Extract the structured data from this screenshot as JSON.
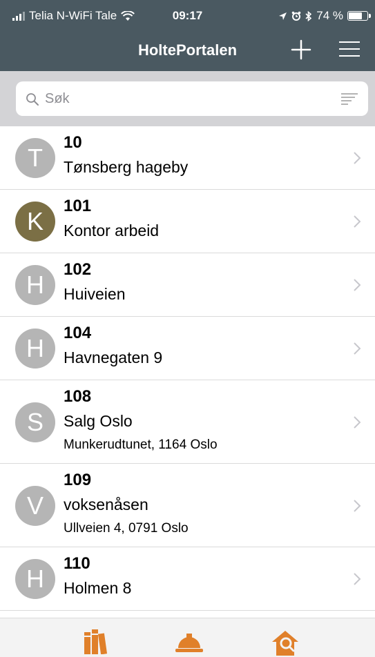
{
  "status_bar": {
    "carrier": "Telia N-WiFi Tale",
    "time": "09:17",
    "battery": "74 %",
    "battery_level": 0.74
  },
  "nav": {
    "title": "HoltePortalen"
  },
  "search": {
    "placeholder": "Søk",
    "value": ""
  },
  "colors": {
    "header": "#4a5961",
    "avatar_default": "#b5b5b5",
    "avatar_k": "#7b6f45",
    "tab_icon": "#e0802a"
  },
  "projects": [
    {
      "number": "10",
      "name": "Tønsberg hageby",
      "address": "",
      "initial": "T"
    },
    {
      "number": "101",
      "name": "Kontor arbeid",
      "address": "",
      "initial": "K"
    },
    {
      "number": "102",
      "name": "Huiveien",
      "address": "",
      "initial": "H"
    },
    {
      "number": "104",
      "name": "Havnegaten 9",
      "address": "",
      "initial": "H"
    },
    {
      "number": "108",
      "name": "Salg Oslo",
      "address": "Munkerudtunet, 1164 Oslo",
      "initial": "S"
    },
    {
      "number": "109",
      "name": "voksenåsen",
      "address": "Ullveien 4, 0791 Oslo",
      "initial": "V"
    },
    {
      "number": "110",
      "name": "Holmen 8",
      "address": "",
      "initial": "H"
    }
  ],
  "tabs": [
    {
      "icon": "books-icon"
    },
    {
      "icon": "hard-hat-icon"
    },
    {
      "icon": "house-search-icon"
    }
  ]
}
